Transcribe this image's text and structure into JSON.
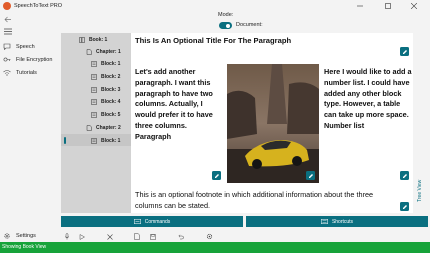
{
  "app": {
    "title": "SpeechToText PRO"
  },
  "nav": {
    "items": [
      {
        "label": "Speech",
        "icon": "speech-icon"
      },
      {
        "label": "File Encryption",
        "icon": "key-icon"
      },
      {
        "label": "Tutorials",
        "icon": "wifi-icon"
      }
    ],
    "settings_label": "Settings"
  },
  "mode": {
    "label": "Mode:",
    "value_label": "Document:",
    "enabled": true
  },
  "tree": {
    "nodes": [
      {
        "label": "Book: 1"
      },
      {
        "label": "Chapter: 1"
      },
      {
        "label": "Block: 1"
      },
      {
        "label": "Block: 2"
      },
      {
        "label": "Block: 3"
      },
      {
        "label": "Block: 4"
      },
      {
        "label": "Block: 5"
      },
      {
        "label": "Chapter: 2"
      },
      {
        "label": "Block: 1"
      }
    ],
    "selected_index": 8
  },
  "document": {
    "title": "This Is An Optional Title For The Paragraph",
    "col1": "Let's add another paragraph. I want this paragraph to have two columns. Actually, I would prefer it to have three columns. Paragraph",
    "col3": "Here I would like to add a number list. I could have added any other block type. However, a table can take up more space. Number list",
    "footnote": "This is an optional footnote in which additional information about the three columns can be stated."
  },
  "side_tab": "Tree View",
  "buttons": {
    "commands": "Commands",
    "shortcuts": "Shortcuts"
  },
  "status": {
    "text": "Showing Book View"
  },
  "colors": {
    "accent": "#0a6f80",
    "status": "#17a33a",
    "tree_bg": "#d3d3d3"
  }
}
